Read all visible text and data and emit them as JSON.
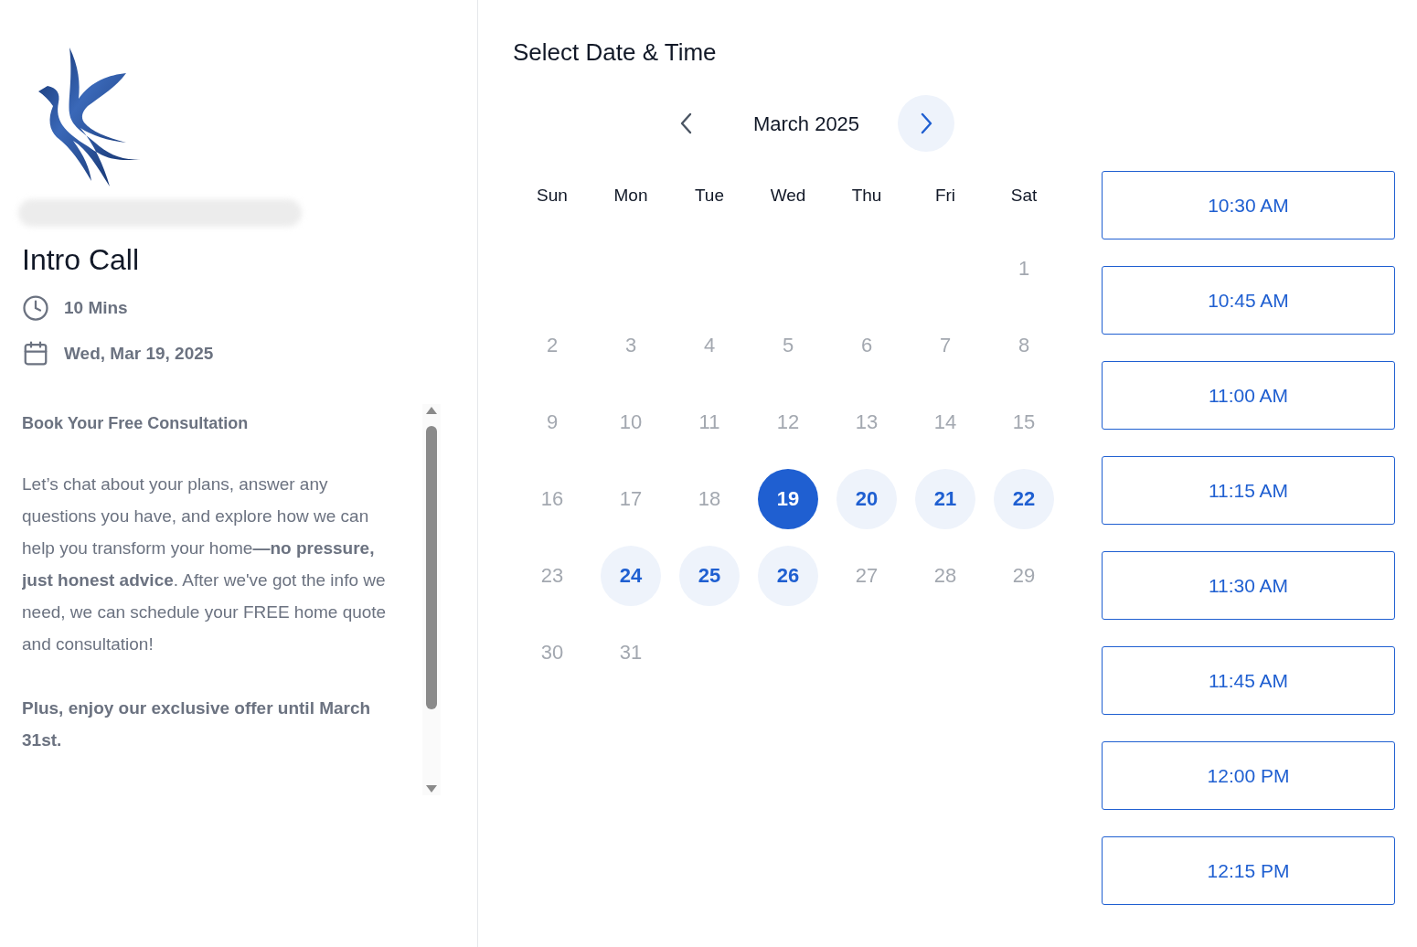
{
  "event": {
    "title": "Intro Call",
    "duration": "10 Mins",
    "date": "Wed, Mar 19, 2025"
  },
  "description": {
    "heading": "Book Your Free Consultation",
    "paragraphs": [
      "Let’s chat about your plans, answer any questions you have, and explore how we can help you transform your home**—no pressure, just honest advice**. After we've got the info we need, we can schedule your FREE home quote and consultation!",
      "**Plus, enjoy our exclusive offer until March 31st.**"
    ]
  },
  "picker": {
    "title": "Select Date & Time",
    "month": "March 2025",
    "weekdays": [
      "Sun",
      "Mon",
      "Tue",
      "Wed",
      "Thu",
      "Fri",
      "Sat"
    ],
    "weeks": [
      [
        {
          "day": "1",
          "available": false,
          "selected": false
        }
      ],
      [
        {
          "day": "2",
          "available": false,
          "selected": false
        },
        {
          "day": "3",
          "available": false,
          "selected": false
        },
        {
          "day": "4",
          "available": false,
          "selected": false
        },
        {
          "day": "5",
          "available": false,
          "selected": false
        },
        {
          "day": "6",
          "available": false,
          "selected": false
        },
        {
          "day": "7",
          "available": false,
          "selected": false
        },
        {
          "day": "8",
          "available": false,
          "selected": false
        }
      ],
      [
        {
          "day": "9",
          "available": false,
          "selected": false
        },
        {
          "day": "10",
          "available": false,
          "selected": false
        },
        {
          "day": "11",
          "available": false,
          "selected": false
        },
        {
          "day": "12",
          "available": false,
          "selected": false
        },
        {
          "day": "13",
          "available": false,
          "selected": false
        },
        {
          "day": "14",
          "available": false,
          "selected": false
        },
        {
          "day": "15",
          "available": false,
          "selected": false
        }
      ],
      [
        {
          "day": "16",
          "available": false,
          "selected": false
        },
        {
          "day": "17",
          "available": false,
          "selected": false
        },
        {
          "day": "18",
          "available": false,
          "selected": false
        },
        {
          "day": "19",
          "available": true,
          "selected": true
        },
        {
          "day": "20",
          "available": true,
          "selected": false
        },
        {
          "day": "21",
          "available": true,
          "selected": false
        },
        {
          "day": "22",
          "available": true,
          "selected": false
        }
      ],
      [
        {
          "day": "23",
          "available": false,
          "selected": false
        },
        {
          "day": "24",
          "available": true,
          "selected": false
        },
        {
          "day": "25",
          "available": true,
          "selected": false
        },
        {
          "day": "26",
          "available": true,
          "selected": false
        },
        {
          "day": "27",
          "available": false,
          "selected": false
        },
        {
          "day": "28",
          "available": false,
          "selected": false
        },
        {
          "day": "29",
          "available": false,
          "selected": false
        }
      ],
      [
        {
          "day": "30",
          "available": false,
          "selected": false
        },
        {
          "day": "31",
          "available": false,
          "selected": false
        }
      ]
    ],
    "times": [
      "10:30 AM",
      "10:45 AM",
      "11:00 AM",
      "11:15 AM",
      "11:30 AM",
      "11:45 AM",
      "12:00 PM",
      "12:15 PM"
    ]
  }
}
